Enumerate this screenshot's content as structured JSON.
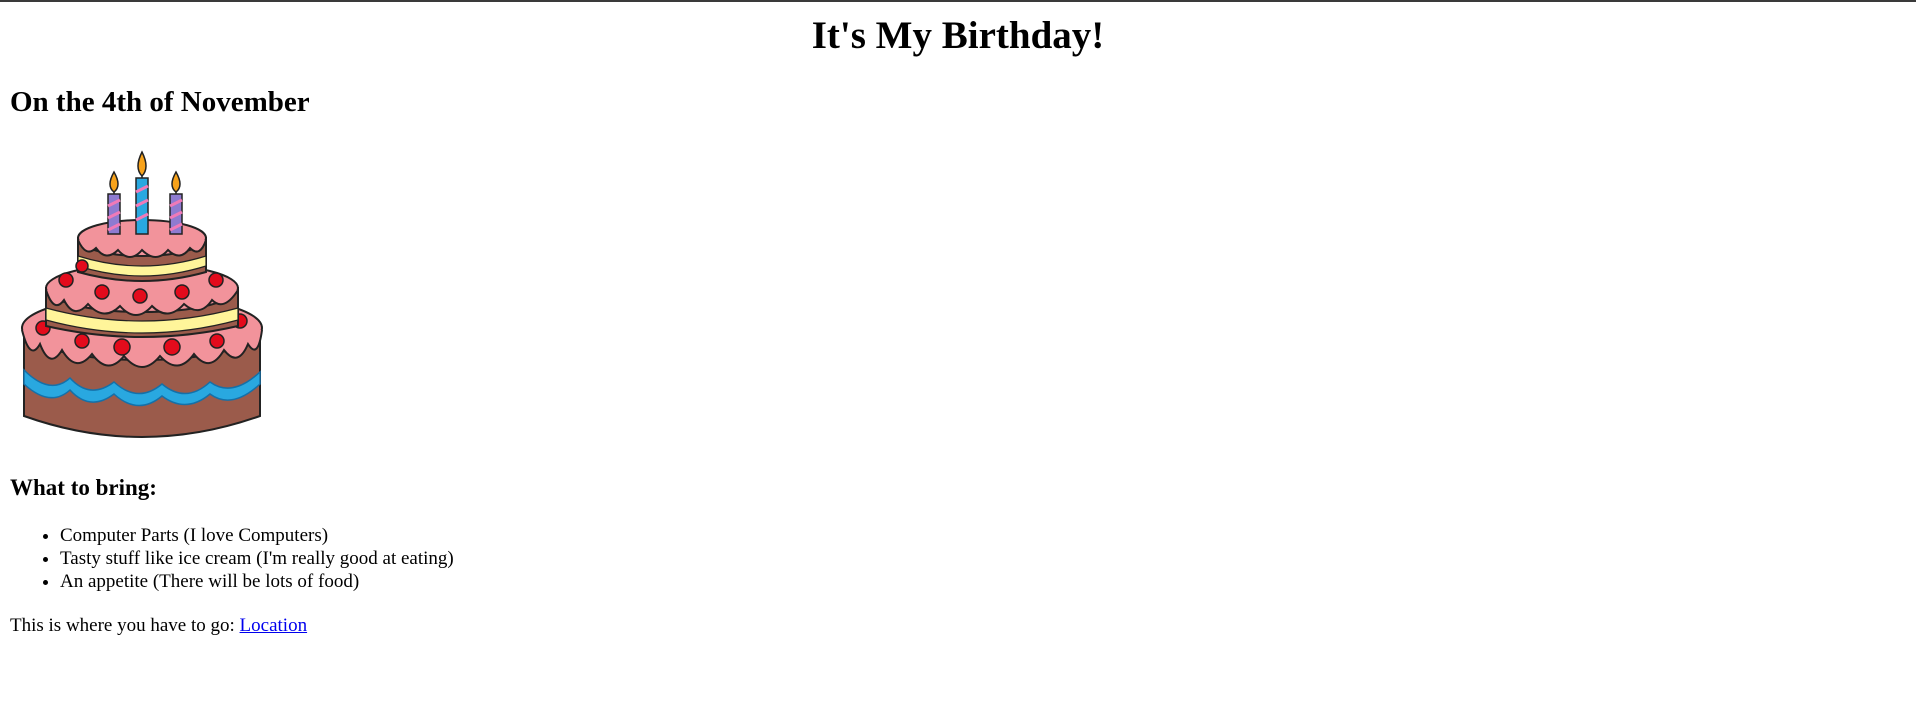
{
  "page": {
    "title": "It's My Birthday!",
    "subtitle": "On the 4th of November"
  },
  "bring": {
    "heading": "What to bring:",
    "items": [
      "Computer Parts (I love Computers)",
      "Tasty stuff like ice cream (I'm really good at eating)",
      "An appetite (There will be lots of food)"
    ]
  },
  "location": {
    "prefix": "This is where you have to go: ",
    "link_label": "Location"
  },
  "colors": {
    "link": "#0000ee",
    "frosting": "#f2939b",
    "cake": "#9b5b4b",
    "cream": "#fff59a",
    "cherries": "#e30b1c",
    "ribbon": "#29a8e0",
    "candles": "#8e7bd1",
    "flame": "#f7a21b"
  }
}
